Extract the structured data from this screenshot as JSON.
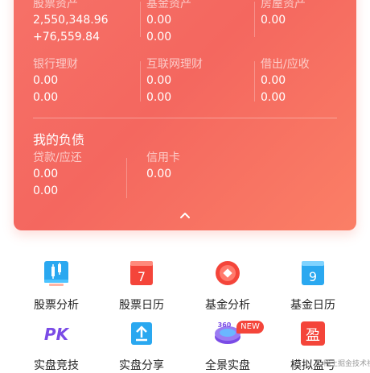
{
  "assets": {
    "total_label": "股票资产",
    "total_value": "2,550,348.96",
    "total_change": "+76,559.84",
    "items": [
      {
        "label": "基金资产",
        "value1": "0.00",
        "value2": "0.00"
      },
      {
        "label": "房屋资产",
        "value1": "0.00"
      },
      {
        "label": "银行理财",
        "value1": "0.00",
        "value2": "0.00"
      },
      {
        "label": "互联网理财",
        "value1": "0.00",
        "value2": "0.00"
      },
      {
        "label": "借出/应收",
        "value1": "0.00",
        "value2": "0.00"
      }
    ]
  },
  "liabilities": {
    "title": "我的负债",
    "items": [
      {
        "label": "贷款/应还",
        "value1": "0.00",
        "value2": "0.00"
      },
      {
        "label": "信用卡",
        "value1": "0.00"
      }
    ]
  },
  "shortcuts": [
    {
      "label": "股票分析",
      "icon": "stock-analysis-icon",
      "color": "#2aa8f0"
    },
    {
      "label": "股票日历",
      "icon": "calendar-7-icon",
      "color": "#f4453a",
      "icon_text": "7"
    },
    {
      "label": "基金分析",
      "icon": "fund-analysis-icon",
      "color": "#f4453a"
    },
    {
      "label": "基金日历",
      "icon": "calendar-9-icon",
      "color": "#2aa8f0",
      "icon_text": "9"
    },
    {
      "label": "实盘竞技",
      "icon": "pk-icon",
      "color": "#7a4be6",
      "icon_text": "PK"
    },
    {
      "label": "实盘分享",
      "icon": "share-upload-icon",
      "color": "#2aa8f0"
    },
    {
      "label": "全景实盘",
      "icon": "panorama-360-icon",
      "color": "#7a4be6",
      "icon_text": "360"
    },
    {
      "label": "模拟盈亏",
      "icon": "simulate-profit-icon",
      "color": "#f4453a",
      "icon_text": "盈"
    }
  ],
  "new_badge": "NEW",
  "watermark": "稀土掘金技术社区"
}
